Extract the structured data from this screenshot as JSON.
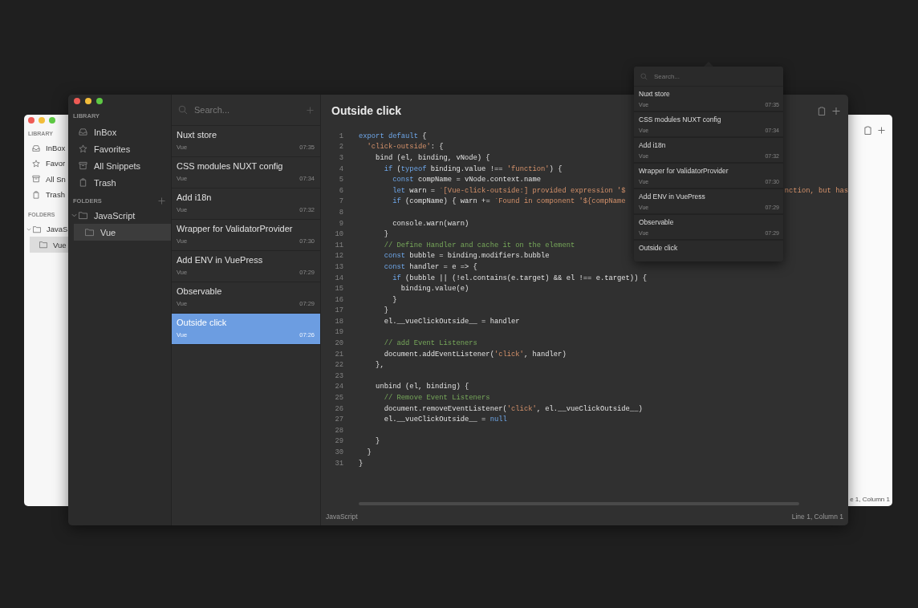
{
  "back_window": {
    "sidebar": {
      "library_label": "LIBRARY",
      "items": [
        {
          "label": "InBox",
          "selected": false
        },
        {
          "label": "Favor",
          "selected": false
        },
        {
          "label": "All Sn",
          "selected": false
        },
        {
          "label": "Trash",
          "selected": false
        }
      ],
      "folders_label": "FOLDERS",
      "folders": [
        {
          "label": "JavaS",
          "expanded": true,
          "children": [
            {
              "label": "Vue",
              "selected": true
            }
          ]
        }
      ]
    },
    "status": "e 1, Column 1"
  },
  "window": {
    "sidebar": {
      "library_label": "LIBRARY",
      "items": [
        {
          "label": "InBox",
          "selected": false
        },
        {
          "label": "Favorites",
          "selected": false
        },
        {
          "label": "All Snippets",
          "selected": false
        },
        {
          "label": "Trash",
          "selected": false
        }
      ],
      "folders_label": "FOLDERS",
      "folders": [
        {
          "label": "JavaScript",
          "expanded": true,
          "children": [
            {
              "label": "Vue",
              "selected": true
            }
          ]
        }
      ]
    },
    "search": {
      "placeholder": "Search..."
    },
    "snippets": [
      {
        "title": "Nuxt store",
        "folder": "Vue",
        "time": "07:35",
        "selected": false
      },
      {
        "title": "CSS modules NUXT config",
        "folder": "Vue",
        "time": "07:34",
        "selected": false
      },
      {
        "title": "Add i18n",
        "folder": "Vue",
        "time": "07:32",
        "selected": false
      },
      {
        "title": "Wrapper for ValidatorProvider",
        "folder": "Vue",
        "time": "07:30",
        "selected": false
      },
      {
        "title": "Add ENV in VuePress",
        "folder": "Vue",
        "time": "07:29",
        "selected": false
      },
      {
        "title": "Observable",
        "folder": "Vue",
        "time": "07:29",
        "selected": false
      },
      {
        "title": "Outside click",
        "folder": "Vue",
        "time": "07:26",
        "selected": true
      }
    ],
    "editor": {
      "title": "Outside click",
      "lines": [
        {
          "n": "1",
          "tokens": [
            {
              "kind": "keyword",
              "text": "export default"
            },
            {
              "kind": "plain",
              "text": " {"
            }
          ]
        },
        {
          "n": "2",
          "tokens": [
            {
              "kind": "string",
              "text": "  'click-outside'"
            },
            {
              "kind": "plain",
              "text": ": {"
            }
          ]
        },
        {
          "n": "3",
          "tokens": [
            {
              "kind": "plain",
              "text": "    bind (el, binding, vNode) {"
            }
          ]
        },
        {
          "n": "4",
          "tokens": [
            {
              "kind": "keyword",
              "text": "      if"
            },
            {
              "kind": "plain",
              "text": " ("
            },
            {
              "kind": "keyword",
              "text": "typeof"
            },
            {
              "kind": "plain",
              "text": " binding.value !== "
            },
            {
              "kind": "string",
              "text": "'function'"
            },
            {
              "kind": "plain",
              "text": ") {"
            }
          ]
        },
        {
          "n": "5",
          "tokens": [
            {
              "kind": "keyword",
              "text": "        const"
            },
            {
              "kind": "plain",
              "text": " compName = vNode.context.name"
            }
          ]
        },
        {
          "n": "6",
          "tokens": [
            {
              "kind": "keyword",
              "text": "        let"
            },
            {
              "kind": "plain",
              "text": " warn = "
            },
            {
              "kind": "string",
              "text": "`[Vue-click-outside:] provided expression '$"
            }
          ],
          "tail": [
            {
              "kind": "string",
              "text": "nction, but has"
            }
          ]
        },
        {
          "n": "7",
          "tokens": [
            {
              "kind": "keyword",
              "text": "        if"
            },
            {
              "kind": "plain",
              "text": " (compName) { warn += "
            },
            {
              "kind": "string",
              "text": "`Found in component '${compName"
            }
          ]
        },
        {
          "n": "8"
        },
        {
          "n": "9",
          "tokens": [
            {
              "kind": "plain",
              "text": "        console.warn(warn)"
            }
          ]
        },
        {
          "n": "10",
          "tokens": [
            {
              "kind": "plain",
              "text": "      }"
            }
          ]
        },
        {
          "n": "11",
          "tokens": [
            {
              "kind": "comment",
              "text": "      // Define Handler and cache it on the element"
            }
          ]
        },
        {
          "n": "12",
          "tokens": [
            {
              "kind": "keyword",
              "text": "      const"
            },
            {
              "kind": "plain",
              "text": " bubble = binding.modifiers.bubble"
            }
          ]
        },
        {
          "n": "13",
          "tokens": [
            {
              "kind": "keyword",
              "text": "      const"
            },
            {
              "kind": "plain",
              "text": " handler = e => {"
            }
          ]
        },
        {
          "n": "14",
          "tokens": [
            {
              "kind": "keyword",
              "text": "        if"
            },
            {
              "kind": "plain",
              "text": " (bubble || (!el.contains(e.target) && el !== e.target)) {"
            }
          ]
        },
        {
          "n": "15",
          "tokens": [
            {
              "kind": "plain",
              "text": "          binding.value(e)"
            }
          ]
        },
        {
          "n": "16",
          "tokens": [
            {
              "kind": "plain",
              "text": "        }"
            }
          ]
        },
        {
          "n": "17",
          "tokens": [
            {
              "kind": "plain",
              "text": "      }"
            }
          ]
        },
        {
          "n": "18",
          "tokens": [
            {
              "kind": "plain",
              "text": "      el.__vueClickOutside__ = handler"
            }
          ]
        },
        {
          "n": "19"
        },
        {
          "n": "20",
          "tokens": [
            {
              "kind": "comment",
              "text": "      // add Event Listeners"
            }
          ]
        },
        {
          "n": "21",
          "tokens": [
            {
              "kind": "plain",
              "text": "      document.addEventListener("
            },
            {
              "kind": "string",
              "text": "'click'"
            },
            {
              "kind": "plain",
              "text": ", handler)"
            }
          ]
        },
        {
          "n": "22",
          "tokens": [
            {
              "kind": "plain",
              "text": "    },"
            }
          ]
        },
        {
          "n": "23"
        },
        {
          "n": "24",
          "tokens": [
            {
              "kind": "plain",
              "text": "    unbind (el, binding) {"
            }
          ]
        },
        {
          "n": "25",
          "tokens": [
            {
              "kind": "comment",
              "text": "      // Remove Event Listeners"
            }
          ]
        },
        {
          "n": "26",
          "tokens": [
            {
              "kind": "plain",
              "text": "      document.removeEventListener("
            },
            {
              "kind": "string",
              "text": "'click'"
            },
            {
              "kind": "plain",
              "text": ", el.__vueClickOutside__)"
            }
          ]
        },
        {
          "n": "27",
          "tokens": [
            {
              "kind": "plain",
              "text": "      el.__vueClickOutside__ = "
            },
            {
              "kind": "keyword",
              "text": "null"
            }
          ]
        },
        {
          "n": "28"
        },
        {
          "n": "29",
          "tokens": [
            {
              "kind": "plain",
              "text": "    }"
            }
          ]
        },
        {
          "n": "30",
          "tokens": [
            {
              "kind": "plain",
              "text": "  }"
            }
          ]
        },
        {
          "n": "31",
          "tokens": [
            {
              "kind": "plain",
              "text": "}"
            }
          ]
        }
      ]
    },
    "status_bar": {
      "language": "JavaScript",
      "position": "Line 1, Column 1"
    }
  },
  "popup": {
    "search": {
      "placeholder": "Search..."
    },
    "items": [
      {
        "title": "Nuxt store",
        "folder": "Vue",
        "time": "07:35"
      },
      {
        "title": "CSS modules NUXT config",
        "folder": "Vue",
        "time": "07:34"
      },
      {
        "title": "Add i18n",
        "folder": "Vue",
        "time": "07:32"
      },
      {
        "title": "Wrapper for ValidatorProvider",
        "folder": "Vue",
        "time": "07:30"
      },
      {
        "title": "Add ENV in VuePress",
        "folder": "Vue",
        "time": "07:29"
      },
      {
        "title": "Observable",
        "folder": "Vue",
        "time": "07:29"
      },
      {
        "title": "Outside click"
      }
    ]
  }
}
